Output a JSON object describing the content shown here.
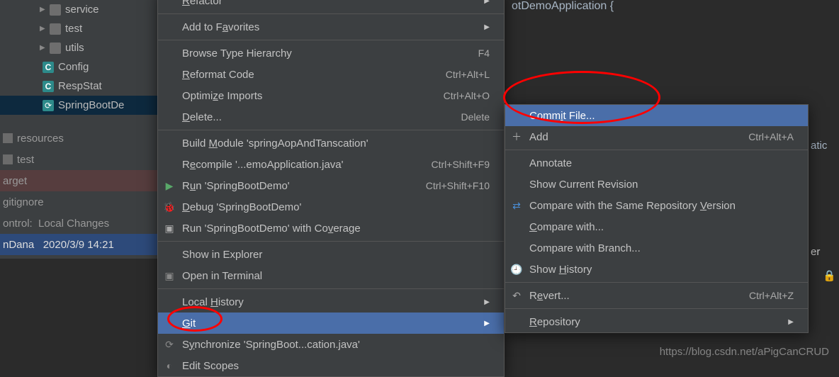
{
  "tree": {
    "items": [
      {
        "label": "service",
        "type": "folder",
        "depth": 2,
        "expand": true
      },
      {
        "label": "test",
        "type": "folder",
        "depth": 2,
        "expand": true
      },
      {
        "label": "utils",
        "type": "folder",
        "depth": 2,
        "expand": true
      },
      {
        "label": "Config",
        "type": "class",
        "depth": 3
      },
      {
        "label": "RespStat",
        "type": "class",
        "depth": 3
      },
      {
        "label": "SpringBootDe",
        "type": "spring",
        "depth": 3,
        "selected": true
      }
    ]
  },
  "bottom": {
    "resources": "resources",
    "test": "test",
    "arget": "arget",
    "gitignore": "gitignore",
    "ontrol": "ontrol:",
    "local_changes": "Local Changes",
    "ndana": "nDana",
    "date": "2020/3/9 14:21"
  },
  "code": "otDemoApplication {",
  "menu1": {
    "refactor": "Refactor",
    "add_favorites": "Add to Favorites",
    "browse_hierarchy": "Browse Type Hierarchy",
    "browse_hierarchy_key": "F4",
    "reformat": "Reformat Code",
    "reformat_key": "Ctrl+Alt+L",
    "optimize": "Optimize Imports",
    "optimize_key": "Ctrl+Alt+O",
    "delete": "Delete...",
    "delete_key": "Delete",
    "build_module": "Build Module 'springAopAndTanscation'",
    "recompile": "Recompile '...emoApplication.java'",
    "recompile_key": "Ctrl+Shift+F9",
    "run": "Run 'SpringBootDemo'",
    "run_key": "Ctrl+Shift+F10",
    "debug": "Debug 'SpringBootDemo'",
    "run_coverage": "Run 'SpringBootDemo' with Coverage",
    "show_explorer": "Show in Explorer",
    "open_terminal": "Open in Terminal",
    "local_history": "Local History",
    "git": "Git",
    "synchronize": "Synchronize 'SpringBoot...cation.java'",
    "edit_scopes": "Edit Scopes"
  },
  "menu2": {
    "commit": "Commit File...",
    "add": "Add",
    "add_key": "Ctrl+Alt+A",
    "annotate": "Annotate",
    "show_current": "Show Current Revision",
    "compare_same": "Compare with the Same Repository Version",
    "compare_with": "Compare with...",
    "compare_branch": "Compare with Branch...",
    "show_history": "Show History",
    "revert": "Revert...",
    "revert_key": "Ctrl+Alt+Z",
    "repository": "Repository"
  },
  "right_fragment": "atic",
  "right_fragment2": "er",
  "watermark": "https://blog.csdn.net/aPigCanCRUD"
}
